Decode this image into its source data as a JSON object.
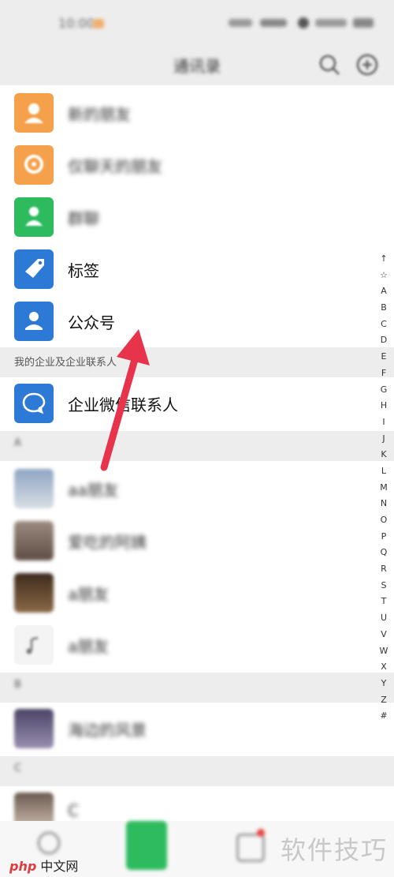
{
  "status_bar": {
    "time": "10:00"
  },
  "header": {
    "title": "通讯录"
  },
  "menu_items": [
    {
      "label": "新的朋友",
      "color": "#f5a04a",
      "blurred": true
    },
    {
      "label": "仅聊天的朋友",
      "color": "#f5a04a",
      "blurred": true
    },
    {
      "label": "群聊",
      "color": "#2dbb5e",
      "blurred": true
    },
    {
      "label": "标签",
      "color": "#2c7ad6",
      "blurred": false
    },
    {
      "label": "公众号",
      "color": "#2c7ad6",
      "blurred": false
    }
  ],
  "enterprise_section": {
    "header": "我的企业及企业联系人",
    "item": {
      "label": "企业微信联系人",
      "color": "#2c7ad6"
    }
  },
  "contact_groups": [
    {
      "letter": "A",
      "contacts": [
        "aa朋友",
        "爱吃的阿姨",
        "a朋友",
        "a朋友"
      ]
    },
    {
      "letter": "B",
      "contacts": [
        "海边的风景"
      ]
    },
    {
      "letter": "C",
      "contacts": [
        "C"
      ]
    }
  ],
  "alphabet_index": [
    "↑",
    "☆",
    "A",
    "B",
    "C",
    "D",
    "E",
    "F",
    "G",
    "H",
    "I",
    "J",
    "K",
    "L",
    "M",
    "N",
    "O",
    "P",
    "Q",
    "R",
    "S",
    "T",
    "U",
    "V",
    "W",
    "X",
    "Y",
    "Z",
    "#"
  ],
  "watermark": {
    "text": "软件技巧",
    "brand": "php",
    "site": "中文网"
  }
}
